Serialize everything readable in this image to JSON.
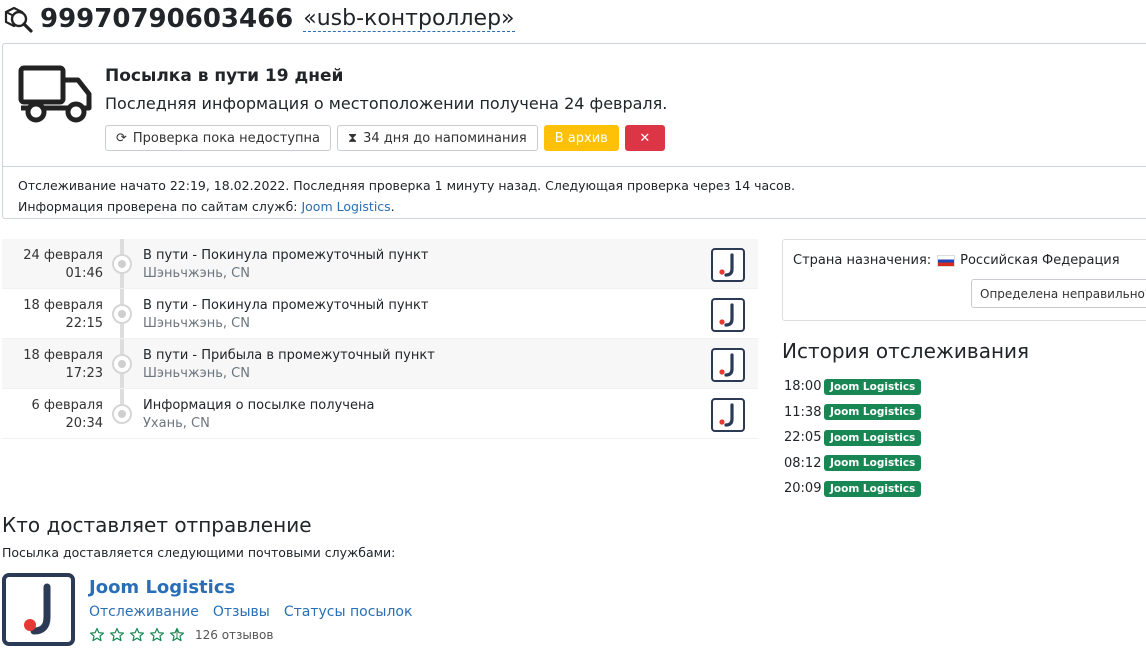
{
  "header": {
    "tracking_number": "99970790603466",
    "parcel_name": "«usb-контроллер»"
  },
  "status": {
    "title": "Посылка в пути 19 дней",
    "subtitle": "Последняя информация о местоположении получена 24 февраля.",
    "btn_check": "Проверка пока недоступна",
    "btn_reminder": "34 дня до напоминания",
    "btn_archive": "В архив",
    "btn_delete": "✕",
    "info_line1": "Отслеживание начато 22:19, 18.02.2022. Последняя проверка 1 минуту назад. Следующая проверка через 14 часов.",
    "info_line2_prefix": "Информация проверена по сайтам служб: ",
    "info_line2_link": "Joom Logistics",
    "info_line2_suffix": "."
  },
  "events": [
    {
      "date": "24 февраля",
      "time": "01:46",
      "title": "В пути - Покинула промежуточный пункт",
      "location": "Шэньчжэнь, CN"
    },
    {
      "date": "18 февраля",
      "time": "22:15",
      "title": "В пути - Покинула промежуточный пункт",
      "location": "Шэньчжэнь, CN"
    },
    {
      "date": "18 февраля",
      "time": "17:23",
      "title": "В пути - Прибыла в промежуточный пункт",
      "location": "Шэньчжэнь, CN"
    },
    {
      "date": "6 февраля",
      "time": "20:34",
      "title": "Информация о посылке получена",
      "location": "Ухань, CN"
    }
  ],
  "destination": {
    "label": "Страна назначения:",
    "country": "Российская Федерация",
    "wrong_btn": "Определена неправильно?"
  },
  "history": {
    "title": "История отслеживания",
    "items": [
      {
        "time": "18:00",
        "service": "Joom Logistics"
      },
      {
        "time": "11:38",
        "service": "Joom Logistics"
      },
      {
        "time": "22:05",
        "service": "Joom Logistics"
      },
      {
        "time": "08:12",
        "service": "Joom Logistics"
      },
      {
        "time": "20:09",
        "service": "Joom Logistics"
      }
    ]
  },
  "carriers": {
    "title": "Кто доставляет отправление",
    "subtitle": "Посылка доставляется следующими почтовыми службами:",
    "name": "Joom Logistics",
    "links": [
      "Отслеживание",
      "Отзывы",
      "Статусы посылок"
    ],
    "rating_stars": 0,
    "reviews": "126 отзывов"
  },
  "colors": {
    "link": "#2a6fb5",
    "warning": "#ffc107",
    "danger": "#dc3545",
    "badge": "#198754",
    "logo_dark": "#2b3a55",
    "logo_red": "#e53935"
  }
}
